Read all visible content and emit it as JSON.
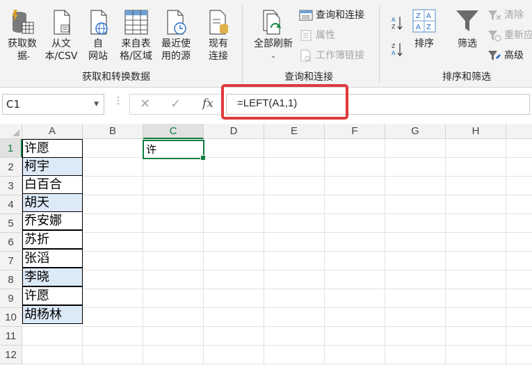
{
  "ribbon": {
    "get_transform": {
      "get_data": "获取数\n据",
      "from_text_csv": "从文\n本/CSV",
      "from_web": "自\n网站",
      "from_table_range": "来自表\n格/区域",
      "recent_sources": "最近使\n用的源",
      "existing_connections": "现有\n连接",
      "group_label": "获取和转换数据"
    },
    "queries": {
      "refresh_all": "全部刷新",
      "queries_connections": "查询和连接",
      "properties": "属性",
      "workbook_links": "工作簿链接",
      "group_label": "查询和连接"
    },
    "sort_filter": {
      "sort": "排序",
      "filter": "筛选",
      "clear": "清除",
      "reapply": "重新应",
      "advanced": "高级",
      "group_label": "排序和筛选"
    }
  },
  "formula_bar": {
    "name_box": "C1",
    "formula": "=LEFT(A1,1)"
  },
  "grid": {
    "columns": [
      "A",
      "B",
      "C",
      "D",
      "E",
      "F",
      "G",
      "H"
    ],
    "rows": [
      "1",
      "2",
      "3",
      "4",
      "5",
      "6",
      "7",
      "8",
      "9",
      "10",
      "11",
      "12"
    ],
    "col_a_values": [
      "许愿",
      "柯宇",
      "白百合",
      "胡天",
      "乔安娜",
      "苏折",
      "张滔",
      "李晓",
      "许愿",
      "胡杨林"
    ],
    "c1_value": "许"
  },
  "colors": {
    "accent_green": "#107c41",
    "highlight_red": "#e0393b",
    "band_blue": "#dce9f6"
  }
}
